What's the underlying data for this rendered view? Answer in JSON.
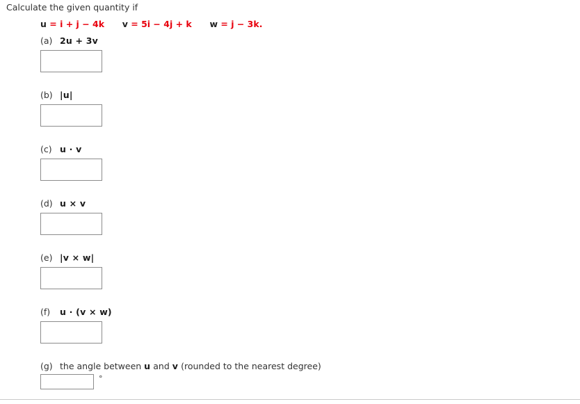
{
  "prompt": "Calculate the given quantity if",
  "given": {
    "u": {
      "name": "u",
      "rest": "= i + j − 4k"
    },
    "v": {
      "name": "v",
      "rest": "= 5i − 4j + k"
    },
    "w": {
      "name": "w",
      "rest": "= j − 3k"
    },
    "terminator": "."
  },
  "items": [
    {
      "tag": "(a)",
      "expr": "2u + 3v",
      "value": "",
      "placeholder": ""
    },
    {
      "tag": "(b)",
      "expr": "|u|",
      "value": "",
      "placeholder": ""
    },
    {
      "tag": "(c)",
      "expr": "u · v",
      "value": "",
      "placeholder": ""
    },
    {
      "tag": "(d)",
      "expr": "u × v",
      "value": "",
      "placeholder": ""
    },
    {
      "tag": "(e)",
      "expr": "|v × w|",
      "value": "",
      "placeholder": ""
    },
    {
      "tag": "(f)",
      "expr": "u · (v × w)",
      "value": "",
      "placeholder": ""
    }
  ],
  "item_g": {
    "tag": "(g)",
    "text_before": "the angle between ",
    "var1": "u",
    "text_middle": " and ",
    "var2": "v",
    "text_after": " (rounded to the nearest degree)",
    "value": "",
    "placeholder": "",
    "unit": "°"
  },
  "colors": {
    "accent_red": "#e8000d",
    "text": "#333333",
    "box_border": "#8c8c8c",
    "divider": "#c9c9c9",
    "background": "#ffffff"
  }
}
